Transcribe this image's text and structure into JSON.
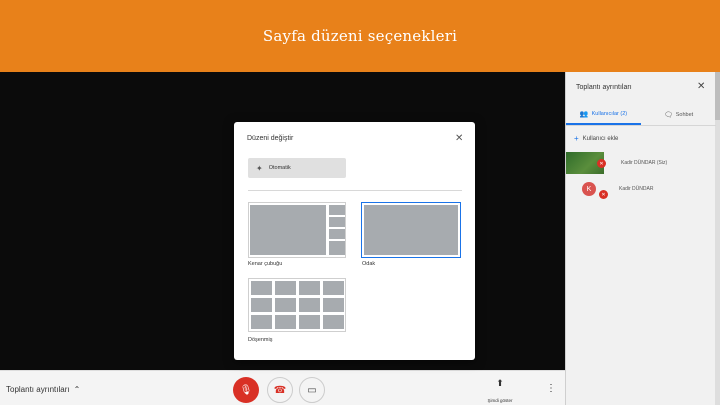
{
  "banner": {
    "title": "Sayfa düzeni seçenekleri"
  },
  "panel": {
    "title": "Toplantı ayrıntıları",
    "tabs": [
      {
        "label": "Kullanıcılar (2)",
        "icon": "people-icon",
        "active": true
      },
      {
        "label": "Sohbet",
        "icon": "chat-icon",
        "active": false
      }
    ],
    "add_user_label": "Kullanıcı ekle",
    "users": [
      {
        "name": "Kadir DÜNDAR (Siz)",
        "avatar": ""
      },
      {
        "name": "Kadir DÜNDAR",
        "avatar": "K"
      }
    ]
  },
  "dialog": {
    "title": "Düzeni değiştir",
    "auto_label": "Otomatik",
    "options": [
      {
        "label": "Kenar çubuğu"
      },
      {
        "label": "Odak"
      },
      {
        "label": "Döşenmiş"
      }
    ]
  },
  "bottom": {
    "meeting_details": "Toplantı ayrıntıları",
    "present_label": "Şimdi göster"
  },
  "colors": {
    "banner": "#e8811a",
    "accent": "#1a73e8",
    "danger": "#d93025"
  }
}
